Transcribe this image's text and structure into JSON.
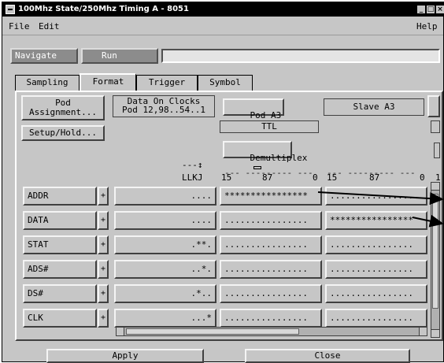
{
  "window": {
    "title": "100Mhz State/250Mhz Timing A - 8051"
  },
  "menu": {
    "file": "File",
    "edit": "Edit",
    "help": "Help"
  },
  "toolbar": {
    "navigate": "Navigate",
    "run": "Run"
  },
  "tabs": [
    "Sampling",
    "Format",
    "Trigger",
    "Symbol"
  ],
  "format": {
    "pod_assignment": "Pod\nAssignment...",
    "setup_hold": "Setup/Hold...",
    "data_on_clocks": "Data On Clocks\nPod 12,98..54..1",
    "pod_a3": "Pod A3",
    "slave_a3": "Slave A3",
    "ttl": "TTL",
    "demultiplex": "Demultiplex",
    "clock_header_top": "---↕",
    "clock_header": "LLKJ",
    "bit_labels_a": {
      "b15": "15",
      "b87": "87",
      "b0": "0"
    },
    "bit_labels_b": {
      "b15": "15",
      "b87": "87",
      "b0": "0",
      "b1": "1"
    }
  },
  "rows": [
    {
      "name": "ADDR",
      "plus": "+",
      "clock": "....",
      "pod1": "****************",
      "pod2": "................"
    },
    {
      "name": "DATA",
      "plus": "+",
      "clock": "....",
      "pod1": "................",
      "pod2": "****************"
    },
    {
      "name": "STAT",
      "plus": "+",
      "clock": ".**.",
      "pod1": "................",
      "pod2": "................"
    },
    {
      "name": "ADS#",
      "plus": "+",
      "clock": "..*.",
      "pod1": "................",
      "pod2": "................"
    },
    {
      "name": "DS#",
      "plus": "+",
      "clock": ".*..",
      "pod1": "................",
      "pod2": "................"
    },
    {
      "name": "CLK",
      "plus": "+",
      "clock": "...*",
      "pod1": "................",
      "pod2": "................"
    }
  ],
  "bottom": {
    "apply": "Apply",
    "close": "Close"
  }
}
